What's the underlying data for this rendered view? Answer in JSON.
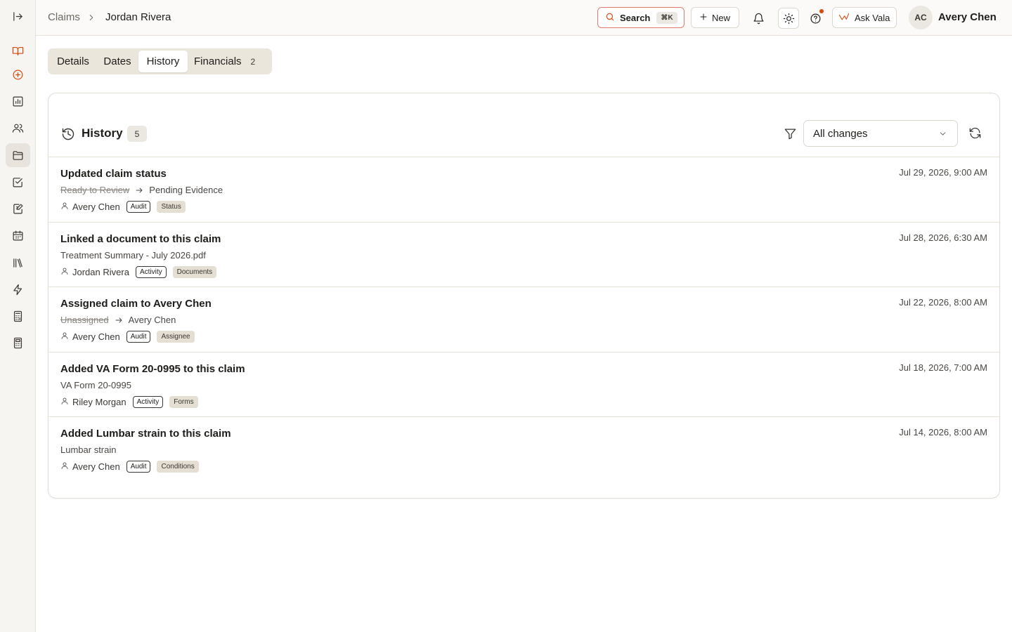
{
  "breadcrumb": {
    "root": "Claims",
    "current": "Jordan Rivera"
  },
  "header": {
    "search_label": "Search",
    "search_shortcut": "⌘K",
    "new_label": "New",
    "ask_label": "Ask Vala",
    "avatar_initials": "AC",
    "user_name": "Avery Chen"
  },
  "tabs": [
    {
      "label": "Details"
    },
    {
      "label": "Dates"
    },
    {
      "label": "History",
      "active": true
    },
    {
      "label": "Financials",
      "count": "2"
    }
  ],
  "history": {
    "title": "History",
    "count": "5",
    "filter_value": "All changes",
    "entries": [
      {
        "title": "Updated claim status",
        "old": "Ready to Review",
        "new": "Pending Evidence",
        "user": "Avery Chen",
        "type": "Audit",
        "category": "Status",
        "time": "Jul 29, 2026, 9:00 AM"
      },
      {
        "title": "Linked a document to this claim",
        "detail": "Treatment Summary - July 2026.pdf",
        "user": "Jordan Rivera",
        "type": "Activity",
        "category": "Documents",
        "time": "Jul 28, 2026, 6:30 AM"
      },
      {
        "title": "Assigned claim to Avery Chen",
        "old": "Unassigned",
        "new": "Avery Chen",
        "user": "Avery Chen",
        "type": "Audit",
        "category": "Assignee",
        "time": "Jul 22, 2026, 8:00 AM"
      },
      {
        "title": "Added VA Form 20-0995 to this claim",
        "detail": "VA Form 20-0995",
        "user": "Riley Morgan",
        "type": "Activity",
        "category": "Forms",
        "time": "Jul 18, 2026, 7:00 AM"
      },
      {
        "title": "Added Lumbar strain to this claim",
        "detail": "Lumbar strain",
        "user": "Avery Chen",
        "type": "Audit",
        "category": "Conditions",
        "time": "Jul 14, 2026, 8:00 AM"
      }
    ]
  },
  "colors": {
    "accent": "#d9480f",
    "sidebar_bg": "#f7f5f1",
    "tab_bg": "#ebe6dc",
    "badge_fill": "#e4ded3"
  },
  "icons": {
    "sidebar": [
      "expand-sidebar-icon",
      "book-open-icon",
      "plus-circle-icon",
      "bar-chart-icon",
      "users-icon",
      "folder-icon",
      "check-square-icon",
      "edit-document-icon",
      "calendar-icon",
      "library-icon",
      "lightning-icon",
      "calculator-icon",
      "calculator-alt-icon"
    ]
  }
}
